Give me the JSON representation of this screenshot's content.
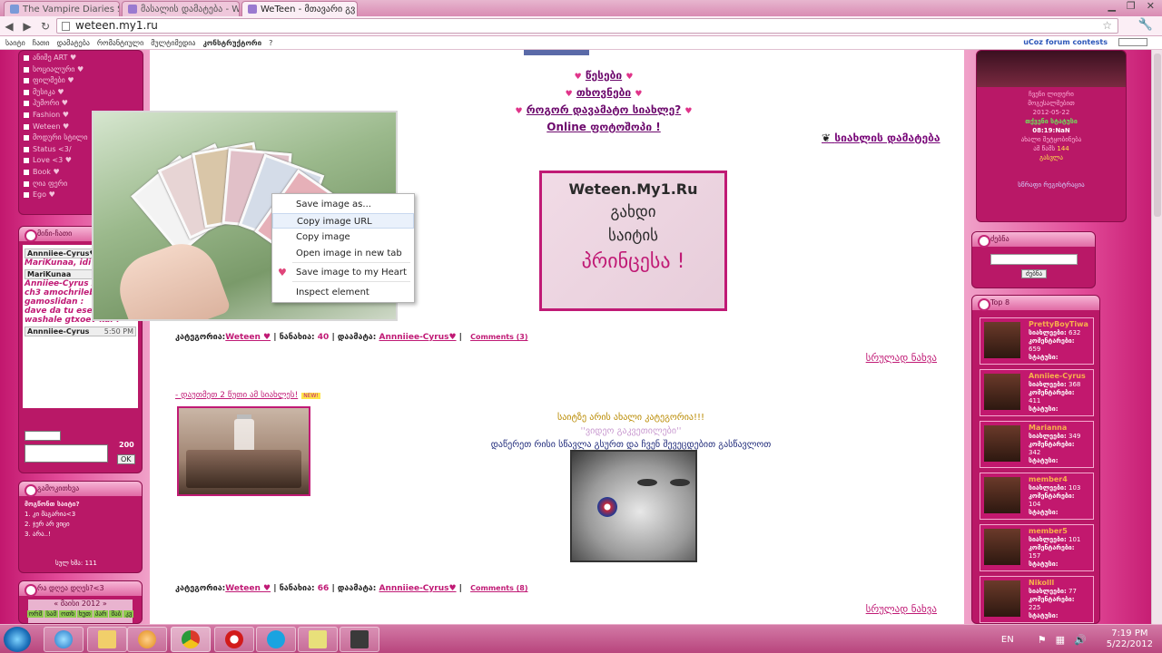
{
  "browser": {
    "tabs": [
      {
        "title": "The Vampire Diaries S",
        "active": false
      },
      {
        "title": "მასალის დამატება - W",
        "active": false
      },
      {
        "title": "WeTeen - მთავარი გვ",
        "active": true
      }
    ],
    "url": "weteen.my1.ru"
  },
  "site_menu": {
    "items": [
      "საიტი",
      "ჩათი",
      "დამატება",
      "რომანტიული",
      "მულტიმედია",
      "კონსტრუქტორი",
      "?"
    ],
    "contest_link": "uCoz forum contests"
  },
  "left_sidebar": {
    "categories": [
      "ანიმე ART ♥",
      "სოციალური ♥",
      "ფილმები ♥",
      "მუსიკა ♥",
      "ჰუმორი ♥",
      "Fashion ♥",
      "Weteen ♥",
      "მოდური სტილი",
      "Status <3/",
      "Love <3 ♥",
      "Book ♥",
      "ღია ფერი",
      "Ego ♥"
    ],
    "chat": {
      "title": "მინი-ჩათი",
      "messages": [
        {
          "user": "Annniiee-Cyrus♥",
          "time": "",
          "text": "MariKunaa, idi"
        },
        {
          "user": "MariKunaa",
          "time": "",
          "text": "Anniiee-Cyrus Xoo ? :\\ ch3 amochrilebiiiaa gamoslidan :"
        },
        {
          "user": "",
          "time": "",
          "text": "dave da tu eseni devs washale gtxoev kai ?"
        },
        {
          "user": "Annniiee-Cyrus",
          "time": "5:50 PM",
          "text": ""
        }
      ],
      "counter": "200",
      "ok_label": "OK"
    },
    "poll": {
      "title": "გამოკითხვა",
      "question": "მოგწონთ საიტი?",
      "options": [
        "1. კი მაგარია<3",
        "2. ჯერ არ ვიცი",
        "3. არა..!"
      ],
      "voted": "სულ ხმა: 111"
    },
    "calendar": {
      "title": "რა დღეა დღეს?<3",
      "month": "« მაისი 2012 »",
      "days": [
        "ორშ",
        "სამ",
        "ოთხ",
        "ხუთ",
        "პარ",
        "შაბ",
        "კვ"
      ]
    }
  },
  "main": {
    "nav_links": [
      "წესები",
      "თხოვნები",
      "როგორ დავამატო სიახლე?"
    ],
    "online": "Online",
    "online_suffix": "ფოტოშოპი !",
    "add_news": "სიახლის დამატება",
    "banner": {
      "line1": "Weteen.My1.Ru",
      "line2": "გახდი",
      "line3": "საიტის",
      "line4": "პრინცესა !"
    },
    "post1": {
      "category_label": "კატეგორია:",
      "category": "Weteen ♥",
      "views_label": "ნანახია:",
      "views": "40",
      "added_label": "დაამატა:",
      "author": "Annniiee-Cyrus♥",
      "comments": "Comments (3)",
      "read_more": "სრულად ნახვა"
    },
    "post2_title": "- დაუთმეთ 2 წუთი ამ სიახლეს!",
    "new_badge": "NEW!",
    "post2": {
      "line1": "საიტზე არის ახალი კატეგორია!!!",
      "line2": "''ვიდეო გაკვეთილები''",
      "line3": "დაწერეთ რისი სწავლა გსურთ და ჩვენ შევეცდებით გასწავლოთ"
    },
    "post3": {
      "category_label": "კატეგორია:",
      "category": "Weteen ♥",
      "views_label": "ნანახია:",
      "views": "66",
      "added_label": "დაამატა:",
      "author": "Annniiee-Cyrus♥",
      "comments": "Comments (8)",
      "read_more": "სრულად ნახვა"
    }
  },
  "context_menu": {
    "items": [
      "Save image as...",
      "Copy image URL",
      "Copy image",
      "Open image in new tab",
      "Save image to my Heart",
      "Inspect element"
    ],
    "highlighted": "Copy image URL"
  },
  "right_sidebar": {
    "profile": {
      "line1": "ჩვენი ლიდერი",
      "line2": "მოგესალმებით",
      "date": "2012-05-22",
      "time": "08:19:NaN",
      "line3": "თქვენი სტატუსი",
      "line4": "ახალი შეტყობინება",
      "count_label": "ამ წამს",
      "count": "144",
      "line5": "გასვლა",
      "bottom": "სწრაფი რეგისტრაცია"
    },
    "search": {
      "title": "ძებნა",
      "button": "ძებნა"
    },
    "top8": {
      "title": "Top 8",
      "members": [
        {
          "name": "PrettyBoyTiwa",
          "news": "632",
          "comments": "659",
          "status": "სტატუსი:"
        },
        {
          "name": "Anniiee-Cyrus",
          "news": "368",
          "comments": "411",
          "status": "სტატუსი:"
        },
        {
          "name": "Marianna",
          "news": "349",
          "comments": "342",
          "status": "სტატუსი:"
        },
        {
          "name": "member4",
          "news": "103",
          "comments": "104",
          "status": "სტატუსი:"
        },
        {
          "name": "member5",
          "news": "101",
          "comments": "157",
          "status": "სტატუსი:"
        },
        {
          "name": "Nikolll",
          "news": "77",
          "comments": "225",
          "status": "სტატუსი:"
        }
      ],
      "news_label": "სიახლეები:",
      "comments_label": "კომენტარები:"
    }
  },
  "taskbar": {
    "lang": "EN",
    "time": "7:19 PM",
    "date": "5/22/2012"
  }
}
